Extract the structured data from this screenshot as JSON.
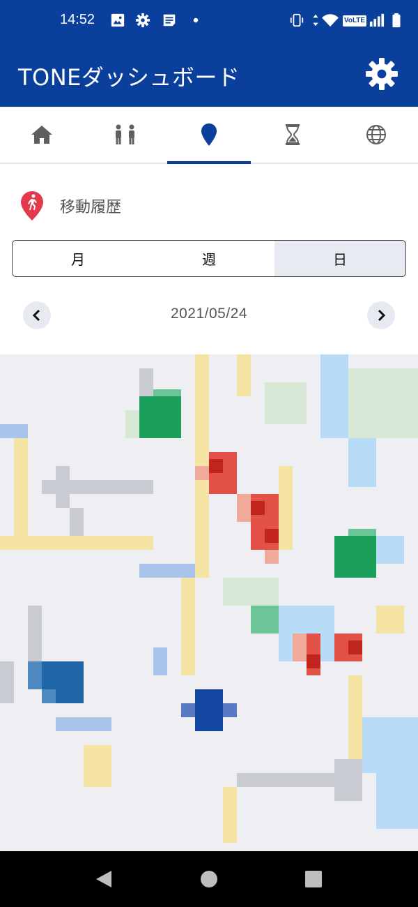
{
  "status_bar": {
    "time": "14:52",
    "left_icons": [
      "image-icon",
      "gear-icon",
      "news-icon",
      "dot-icon"
    ],
    "right_icons": [
      "vibrate-icon",
      "data-arrows-icon",
      "wifi-icon",
      "volte-icon",
      "signal-icon",
      "battery-icon"
    ],
    "volte_text": "VoLTE"
  },
  "app_bar": {
    "title": "TONEダッシュボード",
    "settings_icon": "gear-icon"
  },
  "tabs": [
    {
      "icon": "home-icon",
      "active": false
    },
    {
      "icon": "people-icon",
      "active": false
    },
    {
      "icon": "location-pin-icon",
      "active": true
    },
    {
      "icon": "hourglass-icon",
      "active": false
    },
    {
      "icon": "globe-icon",
      "active": false
    }
  ],
  "section": {
    "icon": "walking-pin-icon",
    "title": "移動履歴"
  },
  "period_selector": {
    "options": [
      "月",
      "週",
      "日"
    ],
    "selected": "日"
  },
  "date_nav": {
    "date": "2021/05/24",
    "prev_icon": "chevron-left-icon",
    "next_icon": "chevron-right-icon"
  },
  "map": {
    "description_icon": "map-icon"
  },
  "system_nav": {
    "buttons": [
      "back-icon",
      "home-circle-icon",
      "recents-icon"
    ]
  },
  "colors": {
    "brand": "#0a3f9c",
    "accent_red": "#e23a4b",
    "selected_segment": "#e8eaf2"
  }
}
